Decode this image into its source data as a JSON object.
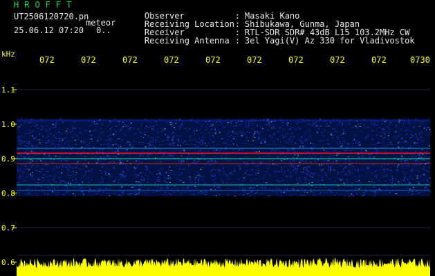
{
  "header": {
    "logo": "HROFFT",
    "file_name": "UT2506120720.pn",
    "tag": "meteor",
    "timestamp": "25.06.12 07:20",
    "count": "0..",
    "rows": [
      {
        "key": "Observer",
        "value": "Masaki Kano"
      },
      {
        "key": "Receiving Location",
        "value": "Shibukawa, Gunma, Japan"
      },
      {
        "key": "Receiver",
        "value": "RTL-SDR SDR# 43dB L15 103.2MHz CW"
      },
      {
        "key": "Receiving Antenna",
        "value": "3el Yagi(V) Az 330 for Vladivostok"
      }
    ]
  },
  "axis": {
    "unit": "kHz",
    "y_ticks": [
      "1.1",
      "1.0",
      "0.9",
      "0.8",
      "0.7",
      "0.6"
    ],
    "x_ticks": [
      "072",
      "072",
      "072",
      "072",
      "072",
      "072",
      "072",
      "072",
      "072",
      "0730"
    ]
  },
  "colors": {
    "label": "#ffff00",
    "logo": "#00e040",
    "text": "#e8e8e8",
    "background": "#000000",
    "signal": "#ff2020",
    "noise_band": "#0030c0",
    "amplitude_bar": "#ffff00"
  }
}
